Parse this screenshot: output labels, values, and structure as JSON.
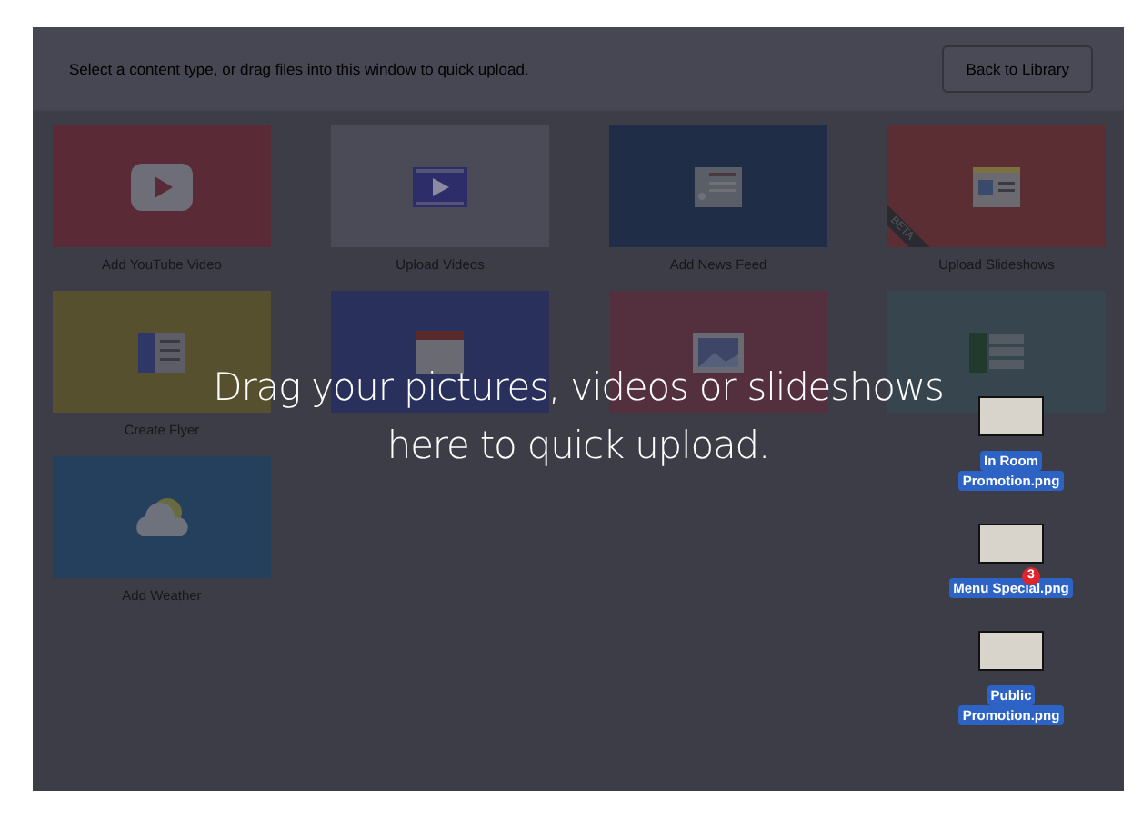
{
  "header": {
    "instruction": "Select a content type, or drag files into this window to quick upload.",
    "back_button": "Back to Library"
  },
  "tiles": [
    {
      "label": "Add YouTube Video",
      "color": "#5a2a36",
      "kind": "youtube"
    },
    {
      "label": "Upload Videos",
      "color": "#4b4b57",
      "kind": "film"
    },
    {
      "label": "Add News Feed",
      "color": "#1f2e46",
      "kind": "news"
    },
    {
      "label": "Upload Slideshows",
      "color": "#5b2e34",
      "kind": "slideshow",
      "ribbon": "BETA"
    },
    {
      "label": "Create Flyer",
      "color": "#56502f",
      "kind": "flyer"
    },
    {
      "color": "#29305c",
      "kind": "calendar"
    },
    {
      "color": "#54303f",
      "kind": "image"
    },
    {
      "color": "#37454e",
      "kind": "table"
    },
    {
      "label": "Add Weather",
      "color": "#24405c",
      "kind": "weather"
    }
  ],
  "overlay": {
    "lines": [
      "Drag your pictures, videos or slideshows",
      "here to quick upload."
    ]
  },
  "dragged_files": [
    {
      "name_lines": [
        "In Room",
        "Promotion.png"
      ]
    },
    {
      "name_lines": [
        "Menu Special.png"
      ],
      "badge": "3"
    },
    {
      "name_lines": [
        "Public",
        "Promotion.png"
      ]
    }
  ]
}
